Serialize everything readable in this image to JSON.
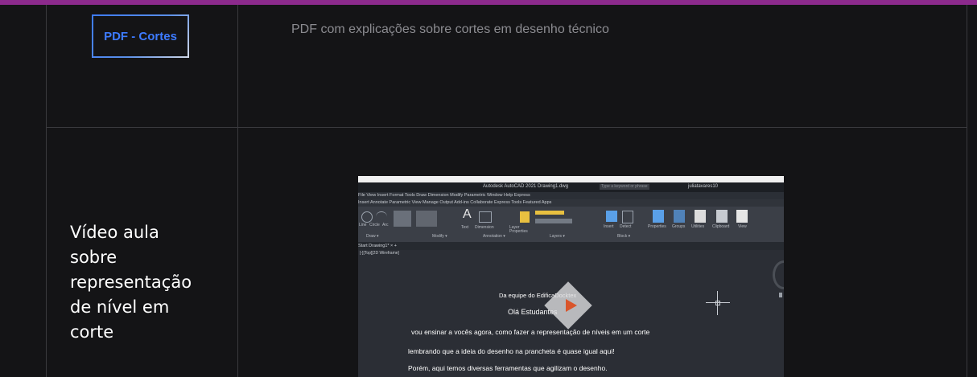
{
  "resources": [
    {
      "button_label": "PDF - Cortes",
      "description": "PDF com explicações sobre cortes em desenho técnico"
    },
    {
      "title": "Vídeo aula\nsobre\nrepresentação\nde nível em\ncorte",
      "video": {
        "app_title": "Autodesk AutoCAD 2021   Drawing1.dwg",
        "search_placeholder": "Type a keyword or phrase",
        "user": "juliatavares10",
        "menu": "File   View   Insert   Format   Tools   Draw   Dimension   Modify   Parametric   Window   Help   Express",
        "ribbon_tabs": "Insert   Annotate   Parametric   View   Manage   Output   Add-ins   Collaborate   Express Tools   Featured Apps",
        "ribbon_groups": {
          "draw": "Draw ▾",
          "modify": "Modify ▾",
          "annotation": "Annotation ▾",
          "layers": "Layers ▾",
          "block": "Block ▾"
        },
        "ribbon_tools": {
          "line": "Line",
          "circle": "Circle",
          "arc": "Arc",
          "text": "Text",
          "dimension": "Dimension",
          "layer_properties": "Layer Properties",
          "insert": "Insert",
          "detect": "Detect",
          "properties": "Properties",
          "groups": "Groups",
          "utilities": "Utilities",
          "clipboard": "Clipboard",
          "view": "View"
        },
        "doc_tabs": "Start    Drawing1*  ×   +",
        "viewport_label": "[-][Top][2D Wireframe]",
        "captions": [
          "Da equipe do EdificaDocktex",
          "Olá Estudantes",
          "vou ensinar a vocês agora, como fazer a representação de níveis em um corte",
          "lembrando que a ideia do desenho na prancheta é quase igual aqui!",
          "Porém, aqui temos diversas ferramentas que agilizam o desenho."
        ]
      }
    }
  ],
  "colors": {
    "background": "#141416",
    "top_accent": "#8c2a8c",
    "button_text": "#3d7bff",
    "play_icon": "#d9552b"
  }
}
